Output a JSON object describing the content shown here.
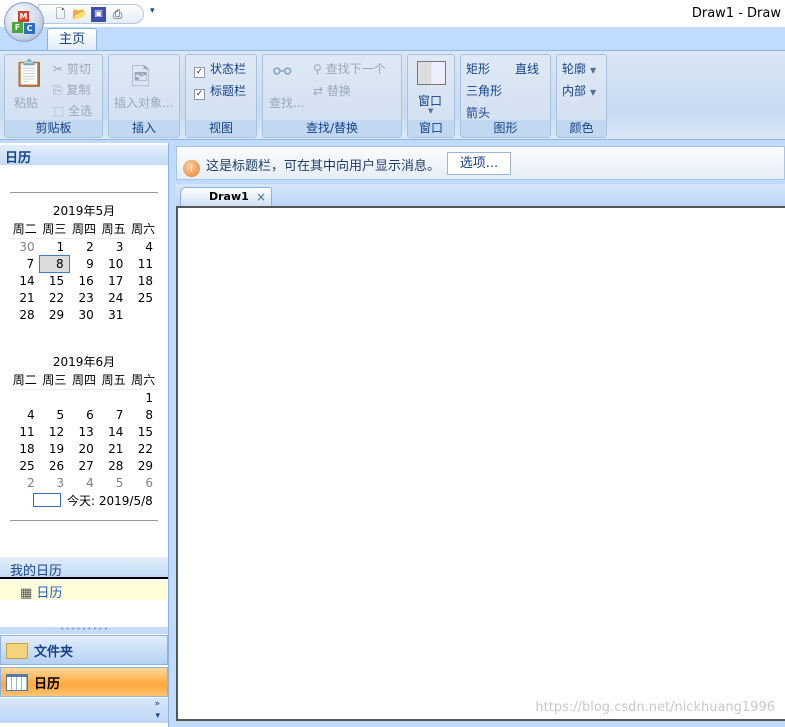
{
  "window": {
    "title": "Draw1 - Draw"
  },
  "app_button": {
    "letters": [
      "M",
      "F",
      "C"
    ]
  },
  "quick_access": {
    "icons": [
      "new-icon",
      "open-icon",
      "save-icon",
      "print-icon"
    ],
    "more": "▾"
  },
  "ribbon": {
    "tabs": [
      {
        "label": "主页"
      }
    ],
    "groups": {
      "clipboard": {
        "label": "剪贴板",
        "paste": "粘贴",
        "cut": "剪切",
        "copy": "复制",
        "select_all": "全选"
      },
      "insert": {
        "label": "插入",
        "insert_object": "插入对象..."
      },
      "view": {
        "label": "视图",
        "status_bar": "状态栏",
        "title_bar": "标题栏",
        "status_bar_checked": true,
        "title_bar_checked": true
      },
      "find": {
        "label": "查找/替换",
        "find": "查找...",
        "find_next": "查找下一个",
        "replace": "替换"
      },
      "window": {
        "label": "窗口",
        "window": "窗口"
      },
      "shapes": {
        "label": "图形",
        "rect": "矩形",
        "line": "直线",
        "triangle": "三角形",
        "arrow": "箭头"
      },
      "colors": {
        "label": "颜色",
        "outline": "轮廓",
        "fill": "内部"
      }
    }
  },
  "left_panel": {
    "header": "日历",
    "calendars": [
      {
        "title": "2019年5月",
        "weekdays": [
          "周二",
          "周三",
          "周四",
          "周五",
          "周六"
        ],
        "weeks": [
          [
            "30",
            "1",
            "2",
            "3",
            "4"
          ],
          [
            "7",
            "8",
            "9",
            "10",
            "11"
          ],
          [
            "14",
            "15",
            "16",
            "17",
            "18"
          ],
          [
            "21",
            "22",
            "23",
            "24",
            "25"
          ],
          [
            "28",
            "29",
            "30",
            "31",
            ""
          ]
        ]
      },
      {
        "title": "2019年6月",
        "weekdays": [
          "周二",
          "周三",
          "周四",
          "周五",
          "周六"
        ],
        "weeks": [
          [
            "",
            "",
            "",
            "",
            "1"
          ],
          [
            "4",
            "5",
            "6",
            "7",
            "8"
          ],
          [
            "11",
            "12",
            "13",
            "14",
            "15"
          ],
          [
            "18",
            "19",
            "20",
            "21",
            "22"
          ],
          [
            "25",
            "26",
            "27",
            "28",
            "29"
          ],
          [
            "2",
            "3",
            "4",
            "5",
            "6"
          ]
        ]
      }
    ],
    "selected_date": "8",
    "today": "今天: 2019/5/8",
    "my_calendars": "我的日历",
    "calendar_item": "日历",
    "nav_buttons": [
      {
        "label": "文件夹"
      },
      {
        "label": "日历"
      }
    ],
    "nav_more": "»"
  },
  "message_bar": {
    "text": "这是标题栏，可在其中向用户显示消息。",
    "button": "选项..."
  },
  "doc_tabs": [
    {
      "label": "Draw1",
      "close": "×"
    }
  ],
  "watermark": "https://blog.csdn.net/nickhuang1996"
}
